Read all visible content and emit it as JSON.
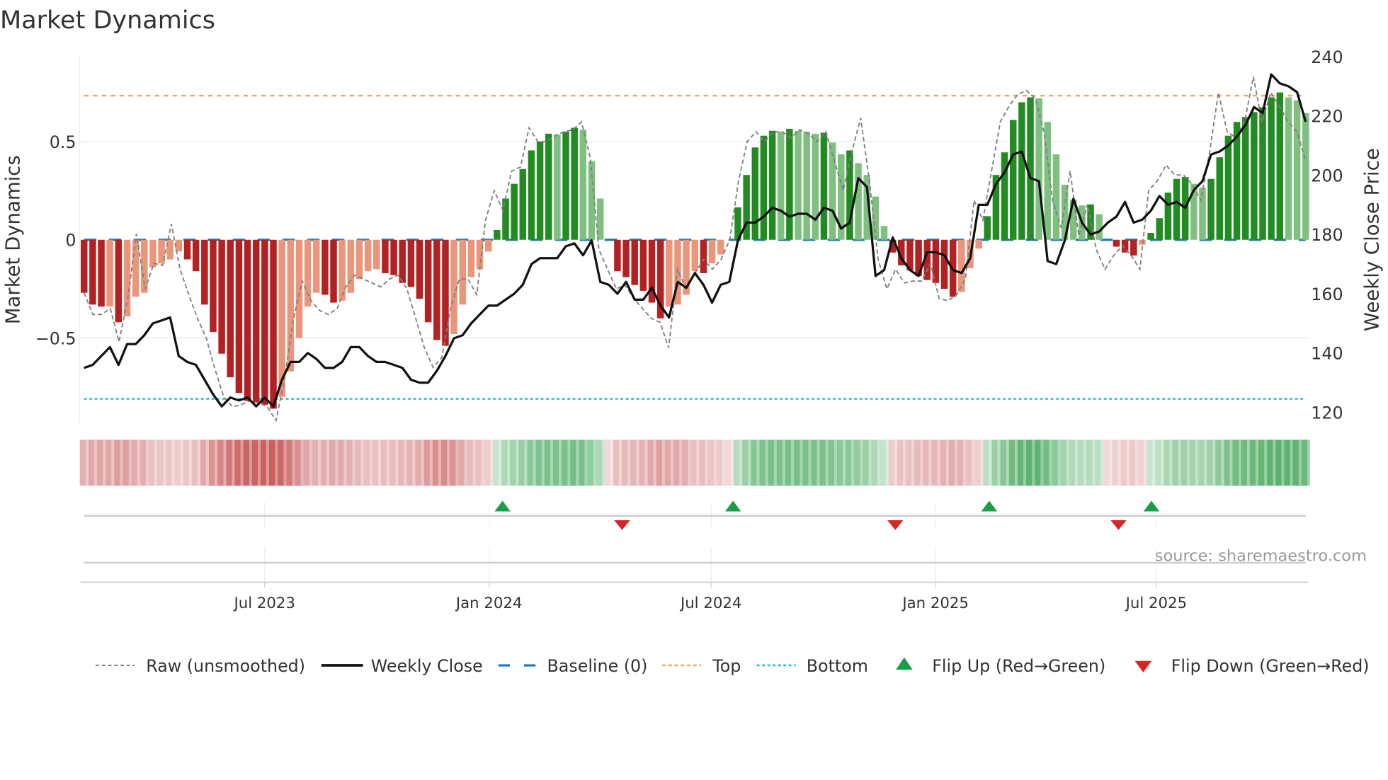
{
  "title": "Market Dynamics",
  "source": "source: sharemaestro.com",
  "colors": {
    "strong_red": "#b22222",
    "weak_red": "#e9967a",
    "strong_green": "#228b22",
    "weak_green": "#7fbf7f",
    "raw": "#808080",
    "close": "#111111",
    "baseline": "#1f77b4",
    "top": "#f4a460",
    "bottom": "#17becf",
    "flip_up": "#1a9e48",
    "flip_down": "#d62728"
  },
  "chart_data": {
    "type": "bar",
    "title": "Market Dynamics",
    "ylabel": "Market Dynamics",
    "y2label": "Weekly Close Price",
    "ylim": [
      -0.93,
      0.93
    ],
    "y2lim": [
      120,
      240
    ],
    "yticks": [
      {
        "v": 0.5,
        "label": "0.5"
      },
      {
        "v": 0,
        "label": "0"
      },
      {
        "v": -0.5,
        "label": "−0.5"
      }
    ],
    "y2ticks": [
      {
        "v": 240,
        "label": "240"
      },
      {
        "v": 220,
        "label": "220"
      },
      {
        "v": 200,
        "label": "200"
      },
      {
        "v": 180,
        "label": "180"
      },
      {
        "v": 160,
        "label": "160"
      },
      {
        "v": 140,
        "label": "140"
      },
      {
        "v": 120,
        "label": "120"
      }
    ],
    "xticks": [
      {
        "date": "2023-07-01",
        "label": "Jul 2023"
      },
      {
        "date": "2024-01-01",
        "label": "Jan 2024"
      },
      {
        "date": "2024-07-01",
        "label": "Jul 2024"
      },
      {
        "date": "2025-01-01",
        "label": "Jan 2025"
      },
      {
        "date": "2025-07-01",
        "label": "Jul 2025"
      }
    ],
    "top_level": 0.734,
    "bottom_level": -0.81,
    "baseline": 0,
    "dynamics": [
      -0.27,
      -0.33,
      -0.34,
      -0.34,
      -0.42,
      -0.39,
      -0.29,
      -0.27,
      -0.14,
      -0.12,
      -0.1,
      -0.06,
      -0.1,
      -0.16,
      -0.33,
      -0.47,
      -0.58,
      -0.7,
      -0.78,
      -0.82,
      -0.83,
      -0.84,
      -0.86,
      -0.8,
      -0.67,
      -0.5,
      -0.34,
      -0.27,
      -0.28,
      -0.32,
      -0.31,
      -0.27,
      -0.2,
      -0.16,
      -0.15,
      -0.17,
      -0.18,
      -0.22,
      -0.24,
      -0.3,
      -0.42,
      -0.51,
      -0.54,
      -0.48,
      -0.33,
      -0.19,
      -0.15,
      -0.06,
      0.05,
      0.21,
      0.285,
      0.36,
      0.455,
      0.5,
      0.54,
      0.535,
      0.55,
      0.57,
      0.56,
      0.4,
      0.21,
      0.0,
      -0.16,
      -0.19,
      -0.23,
      -0.26,
      -0.32,
      -0.4,
      -0.34,
      -0.33,
      -0.28,
      -0.16,
      -0.17,
      -0.12,
      -0.075,
      0.0,
      0.165,
      0.33,
      0.47,
      0.53,
      0.555,
      0.55,
      0.565,
      0.555,
      0.55,
      0.54,
      0.545,
      0.495,
      0.435,
      0.455,
      0.39,
      0.33,
      0.22,
      0.07,
      -0.065,
      -0.13,
      -0.155,
      -0.185,
      -0.205,
      -0.22,
      -0.25,
      -0.29,
      -0.265,
      -0.145,
      -0.045,
      0.12,
      0.33,
      0.445,
      0.61,
      0.7,
      0.725,
      0.72,
      0.6,
      0.435,
      0.28,
      0.205,
      0.175,
      0.18,
      0.13,
      0.0,
      -0.035,
      -0.065,
      -0.08,
      -0.025,
      0.035,
      0.11,
      0.24,
      0.31,
      0.32,
      0.285,
      0.265,
      0.31,
      0.42,
      0.53,
      0.6,
      0.625,
      0.65,
      0.675,
      0.725,
      0.75,
      0.725,
      0.71,
      0.645
    ],
    "strengthening": [
      1,
      1,
      1,
      0,
      1,
      0,
      0,
      0,
      0,
      0,
      0,
      0,
      1,
      1,
      1,
      1,
      1,
      1,
      1,
      1,
      1,
      1,
      1,
      0,
      0,
      0,
      0,
      0,
      1,
      1,
      0,
      0,
      0,
      0,
      0,
      1,
      1,
      1,
      1,
      1,
      1,
      1,
      1,
      0,
      0,
      0,
      0,
      0,
      1,
      1,
      1,
      1,
      1,
      1,
      1,
      0,
      1,
      1,
      0,
      0,
      0,
      0,
      1,
      1,
      1,
      1,
      1,
      1,
      0,
      0,
      0,
      0,
      1,
      0,
      0,
      0,
      1,
      1,
      1,
      1,
      1,
      0,
      1,
      0,
      0,
      0,
      1,
      0,
      0,
      1,
      0,
      0,
      0,
      0,
      1,
      1,
      1,
      1,
      1,
      1,
      1,
      1,
      0,
      0,
      0,
      1,
      1,
      1,
      1,
      1,
      1,
      0,
      0,
      0,
      0,
      0,
      0,
      1,
      0,
      0,
      1,
      1,
      1,
      0,
      1,
      1,
      1,
      1,
      1,
      0,
      0,
      1,
      1,
      1,
      1,
      1,
      1,
      1,
      1,
      1,
      0,
      0,
      0
    ],
    "weekly_close": [
      135,
      136,
      139,
      142,
      136,
      143,
      143,
      146,
      150,
      151,
      152,
      139,
      137,
      136,
      131,
      126,
      122,
      125,
      124,
      125,
      122,
      125,
      122,
      131,
      137,
      137,
      140,
      138,
      135,
      135,
      137,
      142,
      142,
      139,
      137,
      137,
      136,
      135,
      131,
      130,
      130,
      134,
      139,
      145,
      146,
      150,
      153,
      156,
      156,
      158,
      160,
      163,
      170,
      172,
      172,
      172,
      176,
      177,
      173,
      178,
      164,
      163,
      160,
      164,
      158,
      158,
      162,
      156,
      152,
      164,
      162,
      167,
      163,
      157,
      163,
      164,
      178,
      184,
      184,
      186,
      189,
      188,
      186,
      187,
      187,
      185,
      189,
      188,
      182,
      184,
      199,
      196,
      166,
      168,
      179,
      172,
      168,
      166,
      174,
      174,
      173,
      168,
      167,
      172,
      190,
      190,
      197,
      201,
      207,
      208,
      199,
      198,
      171,
      170,
      178,
      192,
      184,
      180,
      181,
      184,
      186,
      191,
      184,
      185,
      188,
      193,
      190,
      191,
      189,
      195,
      198,
      207,
      208,
      210,
      213,
      217,
      223,
      221,
      234,
      231,
      230,
      228,
      218
    ],
    "raw": [
      -0.27,
      -0.38,
      -0.38,
      -0.35,
      -0.52,
      -0.3,
      0.03,
      -0.25,
      -0.12,
      -0.13,
      0.08,
      -0.15,
      -0.28,
      -0.4,
      -0.5,
      -0.66,
      -0.8,
      -0.85,
      -0.84,
      -0.82,
      -0.83,
      -0.85,
      -0.92,
      -0.7,
      -0.4,
      -0.21,
      -0.31,
      -0.36,
      -0.38,
      -0.35,
      -0.24,
      -0.18,
      -0.2,
      -0.22,
      -0.24,
      -0.2,
      -0.18,
      -0.25,
      -0.4,
      -0.55,
      -0.65,
      -0.6,
      -0.35,
      -0.2,
      -0.2,
      -0.28,
      0.1,
      0.25,
      0.15,
      0.35,
      0.37,
      0.57,
      0.5,
      0.5,
      0.53,
      0.55,
      0.56,
      0.6,
      0.42,
      -0.05,
      -0.15,
      -0.25,
      -0.23,
      -0.3,
      -0.35,
      -0.4,
      -0.42,
      -0.55,
      -0.15,
      -0.25,
      -0.17,
      -0.1,
      -0.15,
      -0.1,
      0.0,
      0.3,
      0.5,
      0.55,
      0.5,
      0.55,
      0.55,
      0.52,
      0.56,
      0.54,
      0.5,
      0.55,
      0.4,
      0.25,
      0.45,
      0.62,
      0.3,
      -0.1,
      -0.25,
      -0.15,
      -0.22,
      -0.21,
      -0.21,
      -0.12,
      -0.3,
      -0.31,
      -0.28,
      -0.2,
      0.2,
      0.1,
      0.35,
      0.6,
      0.68,
      0.74,
      0.76,
      0.72,
      0.55,
      0.2,
      0.06,
      0.35,
      0.02,
      0.18,
      -0.05,
      -0.15,
      -0.08,
      -0.03,
      -0.08,
      -0.15,
      0.25,
      0.3,
      0.38,
      0.33,
      0.33,
      0.28,
      0.2,
      0.45,
      0.75,
      0.55,
      0.52,
      0.6,
      0.83,
      0.6,
      0.75,
      0.68,
      0.6,
      0.55,
      0.4
    ],
    "flip_up_dates": [
      "2024-01-12",
      "2024-07-19",
      "2025-02-14",
      "2025-06-27"
    ],
    "flip_down_dates": [
      "2024-04-19",
      "2024-11-29",
      "2025-05-31"
    ]
  },
  "legend": [
    {
      "key": "raw",
      "label": "Raw (unsmoothed)"
    },
    {
      "key": "close",
      "label": "Weekly Close"
    },
    {
      "key": "baseline",
      "label": "Baseline (0)"
    },
    {
      "key": "top",
      "label": "Top"
    },
    {
      "key": "bottom",
      "label": "Bottom"
    },
    {
      "key": "flip_up",
      "label": "Flip Up (Red→Green)"
    },
    {
      "key": "flip_down",
      "label": "Flip Down (Green→Red)"
    }
  ]
}
